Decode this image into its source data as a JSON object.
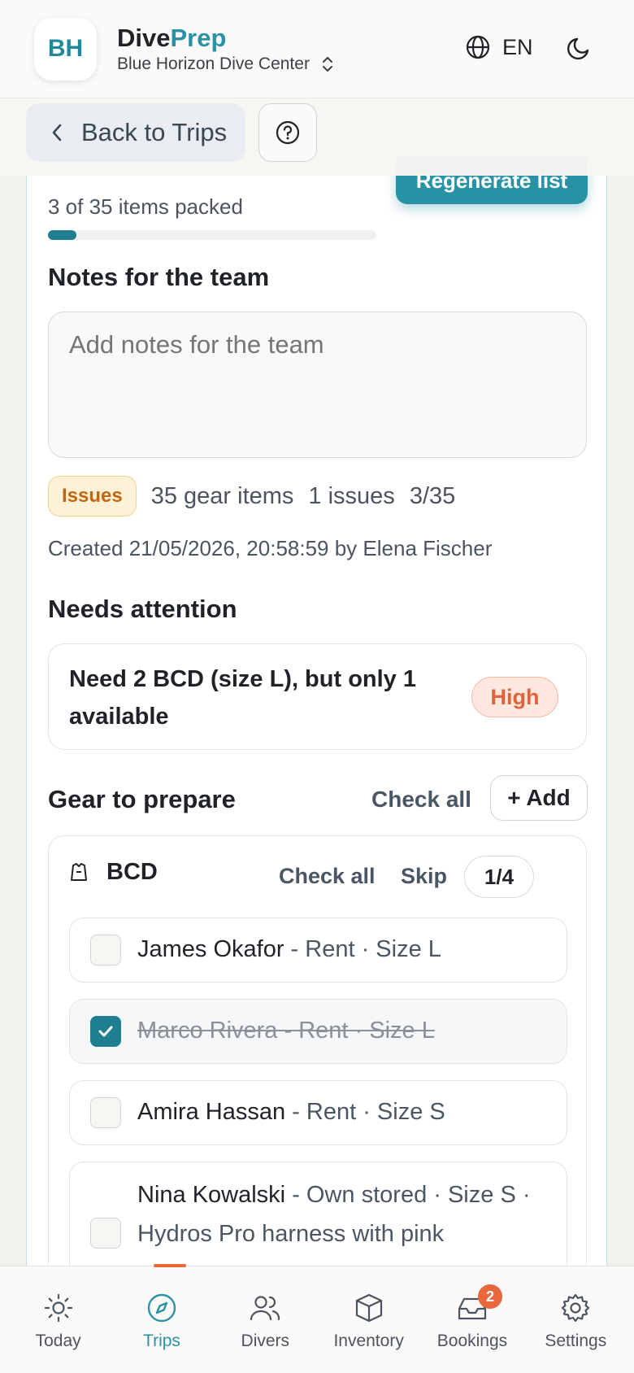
{
  "header": {
    "avatar_initials": "BH",
    "brand_part1": "Dive",
    "brand_part2": "Prep",
    "center_name": "Blue Horizon Dive Center",
    "language": "EN"
  },
  "subbar": {
    "back_label": "Back to Trips"
  },
  "prep": {
    "regenerate_label": "Regenerate list",
    "packed_text": "3 of 35 items packed",
    "progress_fraction": 0.0857,
    "notes_title": "Notes for the team",
    "notes_placeholder": "Add notes for the team",
    "issues_badge": "Issues",
    "gear_items": "35 gear items",
    "issues_count": "1 issues",
    "progress_ratio": "3/35",
    "created_text": "Created 21/05/2026, 20:58:59 by Elena Fischer"
  },
  "attention": {
    "title": "Needs attention",
    "issue_text": "Need 2 BCD (size L), but only 1 available",
    "priority": "High"
  },
  "gear": {
    "title": "Gear to prepare",
    "check_all_label": "Check all",
    "add_label": "+ Add",
    "group": {
      "name": "BCD",
      "check_all_label": "Check all",
      "skip_label": "Skip",
      "count": "1/4",
      "items": [
        {
          "name": "James Okafor",
          "detail": " - Rent · Size L",
          "checked": false
        },
        {
          "name": "Marco Rivera",
          "detail": " - Rent · Size L",
          "checked": true
        },
        {
          "name": "Amira Hassan",
          "detail": " - Rent · Size S",
          "checked": false
        },
        {
          "name": "Nina Kowalski",
          "detail": " - Own stored · Size S · Hydros Pro harness with pink",
          "checked": false
        }
      ]
    }
  },
  "nav": {
    "items": [
      {
        "label": "Today",
        "icon": "sun-icon"
      },
      {
        "label": "Trips",
        "icon": "compass-icon"
      },
      {
        "label": "Divers",
        "icon": "users-icon"
      },
      {
        "label": "Inventory",
        "icon": "box-icon"
      },
      {
        "label": "Bookings",
        "icon": "inbox-icon"
      },
      {
        "label": "Settings",
        "icon": "gear-icon"
      }
    ],
    "bookings_badge": "2"
  },
  "colors": {
    "accent": "#2a92a5",
    "danger": "#e0623a",
    "warning": "#c2660e"
  }
}
